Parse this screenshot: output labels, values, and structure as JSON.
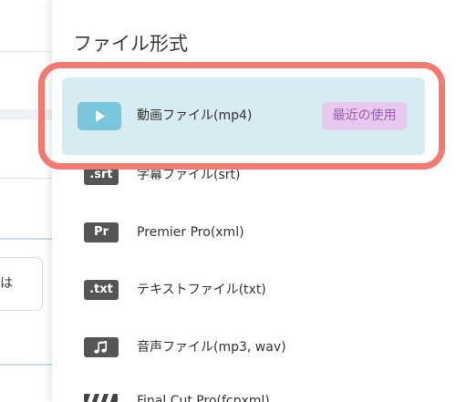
{
  "background": {
    "input_text": "は"
  },
  "panel": {
    "title": "ファイル形式",
    "items": [
      {
        "icon": "play-icon",
        "label": "動画ファイル(mp4)",
        "badge": "最近の使用",
        "selected": true
      },
      {
        "icon": "srt-file-icon",
        "icon_text": ".srt",
        "label": "字幕ファイル(srt)"
      },
      {
        "icon": "premiere-pro-icon",
        "icon_text": "Pr",
        "label": "Premier Pro(xml)"
      },
      {
        "icon": "txt-file-icon",
        "icon_text": ".txt",
        "label": "テキストファイル(txt)"
      },
      {
        "icon": "music-note-icon",
        "label": "音声ファイル(mp3, wav)"
      },
      {
        "icon": "clapperboard-icon",
        "label": "Final Cut Pro(fcpxml)"
      }
    ]
  },
  "colors": {
    "selected_row_bg": "#d6ebf2",
    "play_icon_bg": "#7ac6dc",
    "badge_bg": "#e8c9ee",
    "badge_text": "#9c5db3",
    "file_icon_bg": "#555555",
    "annotation_outline": "#f27a70",
    "text": "#333333"
  }
}
